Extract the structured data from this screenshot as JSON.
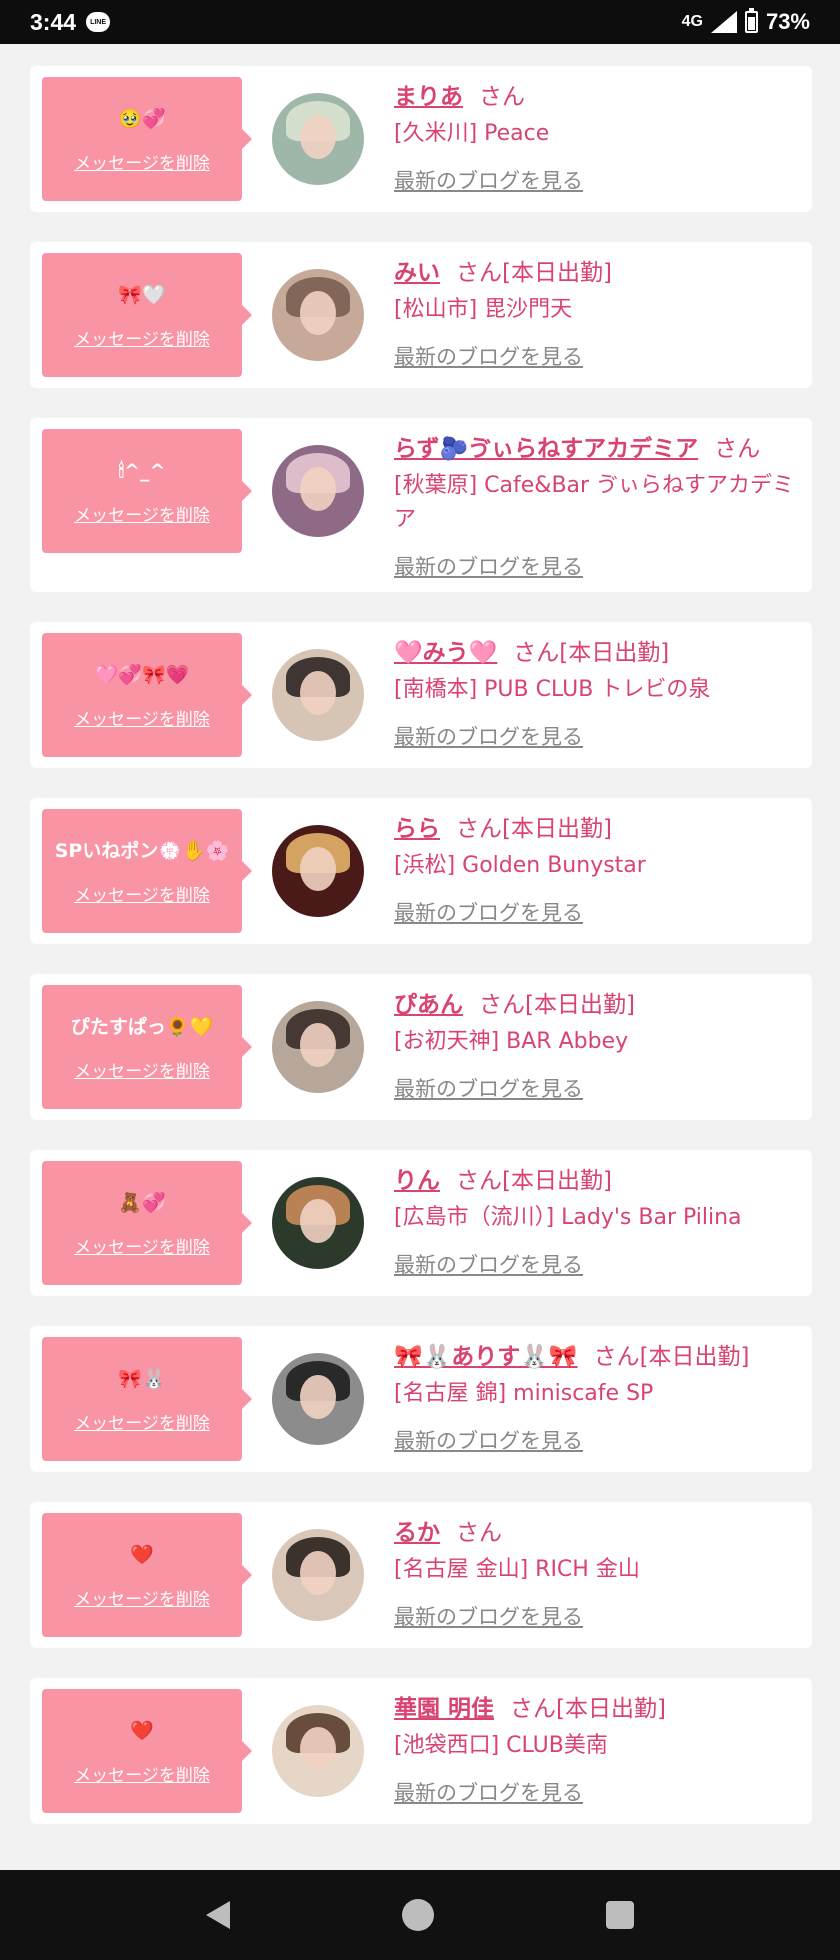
{
  "status_bar": {
    "time": "3:44",
    "app_icon_label": "LINE",
    "network": "4G",
    "battery": "73%"
  },
  "delete_label": "メッセージを削除",
  "blog_label": "最新のブログを見る",
  "cards": [
    {
      "message": "🥹💞",
      "name": "まりあ",
      "suffix": "さん",
      "shop": "[久米川] Peace",
      "avatar_colors": [
        "#9fb7a8",
        "#d9e3d0"
      ]
    },
    {
      "message": "🎀🤍",
      "name": "みい",
      "suffix": "さん[本日出勤]",
      "shop": "[松山市] 毘沙門天",
      "avatar_colors": [
        "#c7a99a",
        "#7a5e52"
      ]
    },
    {
      "message": "🕯^_^",
      "name": "らず🫐ゔぃらねすアカデミア",
      "suffix": "さん",
      "shop": "[秋葉原] Cafe&Bar ゔぃらねすアカデミア",
      "avatar_colors": [
        "#8e6a86",
        "#e6c7d1"
      ]
    },
    {
      "message": "🩷💞🎀💗",
      "name": "🩷みう🩷",
      "suffix": "さん[本日出勤]",
      "shop": "[南橋本] PUB CLUB トレビの泉",
      "avatar_colors": [
        "#d6c4b4",
        "#2f2623"
      ]
    },
    {
      "message": "SPいねポン💮✋🌸",
      "name": "らら",
      "suffix": "さん[本日出勤]",
      "shop": "[浜松] Golden Bunystar",
      "avatar_colors": [
        "#4a1a18",
        "#e3b36a"
      ]
    },
    {
      "message": "ぴたすぱっ🌻💛",
      "name": "ぴあん",
      "suffix": "さん[本日出勤]",
      "shop": "[お初天神] BAR Abbey",
      "avatar_colors": [
        "#b7a69a",
        "#3a2c27"
      ]
    },
    {
      "message": "🧸💞",
      "name": "りん",
      "suffix": "さん[本日出勤]",
      "shop": "[広島市（流川）] Lady's Bar Pilina",
      "avatar_colors": [
        "#2b3a2a",
        "#c98b5a"
      ]
    },
    {
      "message": "🎀🐰",
      "name": "🎀🐰ありす🐰🎀",
      "suffix": "さん[本日出勤]",
      "shop": "[名古屋 錦] miniscafe SP",
      "avatar_colors": [
        "#8c8c8c",
        "#1e1e1e"
      ]
    },
    {
      "message": "❤️",
      "name": "るか",
      "suffix": "さん",
      "shop": "[名古屋 金山] RICH 金山",
      "avatar_colors": [
        "#d9c7b9",
        "#2a211d"
      ]
    },
    {
      "message": "❤️",
      "name": "華園 明佳",
      "suffix": "さん[本日出勤]",
      "shop": "[池袋西口] CLUB美南",
      "avatar_colors": [
        "#e6d6c8",
        "#5a3e2e"
      ]
    }
  ]
}
